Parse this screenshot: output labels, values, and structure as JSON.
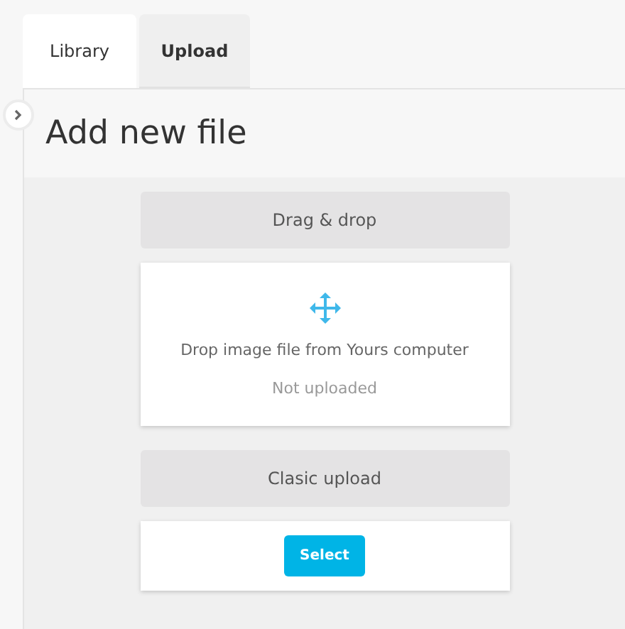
{
  "tabs": [
    {
      "label": "Library",
      "selected": true
    },
    {
      "label": "Upload",
      "selected": false
    }
  ],
  "title": "Add new file",
  "drag_section": {
    "header": "Drag & drop",
    "instruction": "Drop image file from Yours computer",
    "status": "Not uploaded"
  },
  "classic_section": {
    "header": "Clasic upload",
    "button": "Select"
  }
}
